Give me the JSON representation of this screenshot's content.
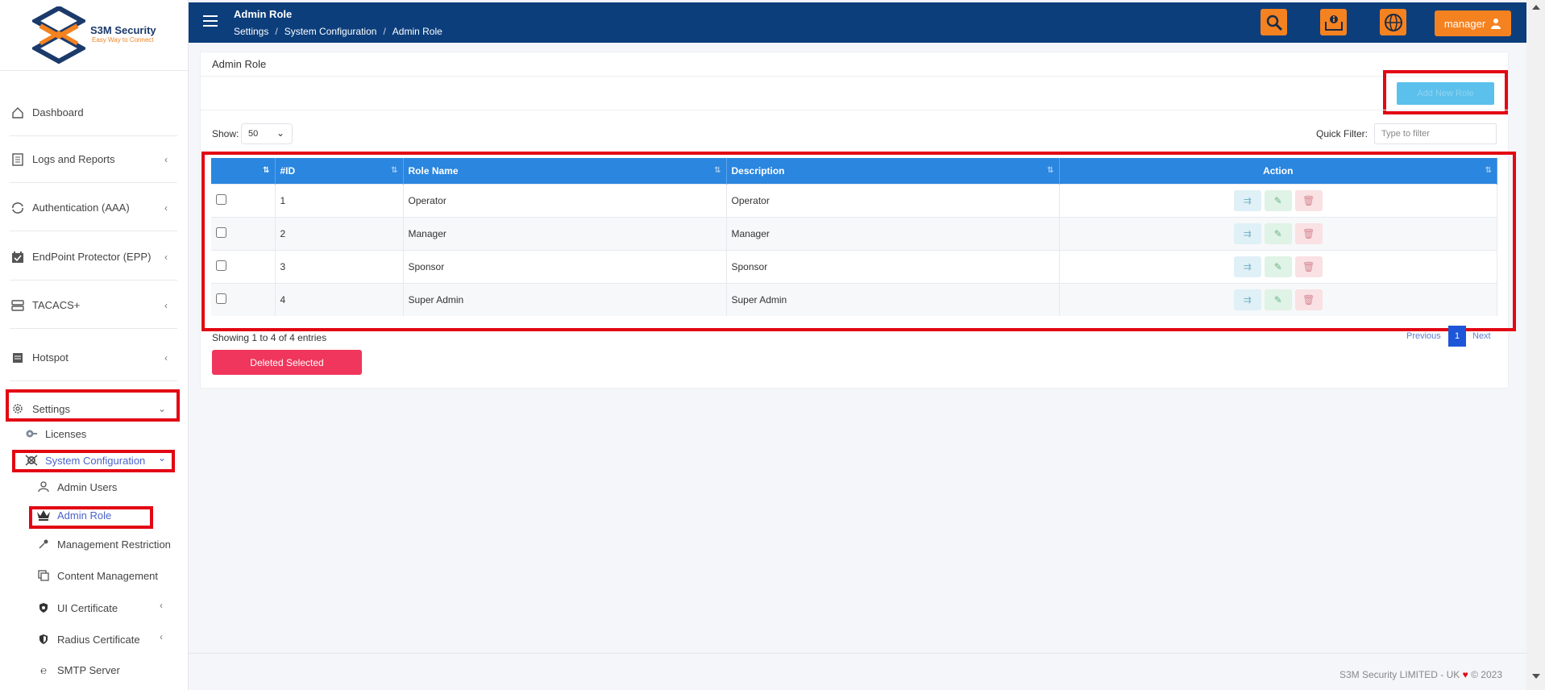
{
  "brand": {
    "name": "S3M Security",
    "tagline": "Easy Way to Connect"
  },
  "sidebar": {
    "items": [
      {
        "label": "Dashboard",
        "icon": "home-icon"
      },
      {
        "label": "Logs and Reports",
        "icon": "document-icon"
      },
      {
        "label": "Authentication (AAA)",
        "icon": "sync-icon"
      },
      {
        "label": "EndPoint Protector (EPP)",
        "icon": "calendar-check-icon"
      },
      {
        "label": "TACACS+",
        "icon": "server-icon"
      },
      {
        "label": "Hotspot",
        "icon": "list-icon"
      },
      {
        "label": "Settings",
        "icon": "gear-icon"
      }
    ],
    "settings_sub": [
      {
        "label": "Licenses"
      },
      {
        "label": "System Configuration"
      }
    ],
    "sysconfig_sub": [
      {
        "label": "Admin Users"
      },
      {
        "label": "Admin Role"
      },
      {
        "label": "Management Restriction"
      },
      {
        "label": "Content Management"
      },
      {
        "label": "UI Certificate"
      },
      {
        "label": "Radius Certificate"
      },
      {
        "label": "SMTP Server"
      }
    ]
  },
  "header": {
    "title": "Admin Role",
    "breadcrumbs": [
      "Settings",
      "System Configuration",
      "Admin Role"
    ],
    "user_label": "manager"
  },
  "card": {
    "title": "Admin Role",
    "new_button": "Add New Role",
    "show_label": "Show:",
    "show_value": "50",
    "filter_label": "Quick Filter:",
    "filter_placeholder": "Type to filter",
    "columns": [
      "#ID",
      "Role Name",
      "Description",
      "Action"
    ],
    "rows": [
      {
        "id": "1",
        "name": "Operator",
        "desc": "Operator"
      },
      {
        "id": "2",
        "name": "Manager",
        "desc": "Manager"
      },
      {
        "id": "3",
        "name": "Sponsor",
        "desc": "Sponsor"
      },
      {
        "id": "4",
        "name": "Super Admin",
        "desc": "Super Admin"
      }
    ],
    "info": "Showing 1 to 4 of 4 entries",
    "delete_selected": "Deleted Selected",
    "pagination": {
      "prev": "Previous",
      "page": "1",
      "next": "Next"
    }
  },
  "footer": {
    "text": "S3M Security LIMITED - UK",
    "year": "© 2023"
  },
  "colors": {
    "navy": "#0c3e7c",
    "orange": "#f58220",
    "table_header": "#2a86df",
    "danger": "#f0365c",
    "highlight": "#e30613"
  }
}
